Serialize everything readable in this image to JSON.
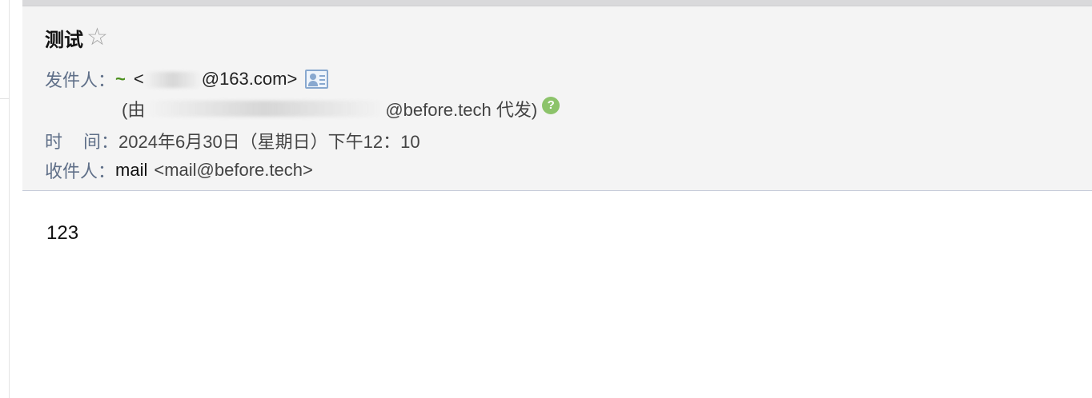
{
  "mail": {
    "subject": "测试",
    "labels": {
      "from": "发件人：",
      "time_a": "时",
      "time_b": "间：",
      "to": "收件人："
    },
    "from": {
      "mark": "~",
      "address_start": "<",
      "address_end": "@163.com>",
      "via_prefix": "(由",
      "via_suffix": "@before.tech 代发)"
    },
    "time": "2024年6月30日（星期日）下午12：10",
    "to": {
      "name": "mail",
      "address": "<mail@before.tech>"
    },
    "body": "123"
  },
  "icons": {
    "star": "star-outline-icon",
    "contact_card": "contact-card-icon",
    "help": "help-circle-icon"
  },
  "colors": {
    "header_bg": "#f4f4f4",
    "label": "#5f6f88",
    "mark": "#4a8f1c",
    "help": "#8cc36a"
  }
}
